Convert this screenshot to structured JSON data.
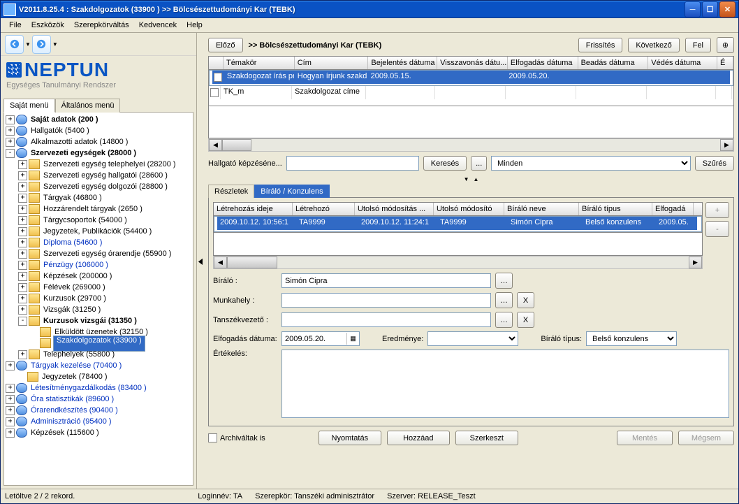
{
  "title": "V2011.8.25.4 : Szakdolgozatok (33900  )  >> Bölcsészettudományi Kar (TEBK)",
  "menu": [
    "File",
    "Eszközök",
    "Szerepkörváltás",
    "Kedvencek",
    "Help"
  ],
  "logo": {
    "name": "NEPTUN",
    "sub": "Egységes Tanulmányi Rendszer"
  },
  "left_tabs": [
    "Saját menü",
    "Általános menü"
  ],
  "tree": [
    {
      "ind": 0,
      "exp": "+",
      "ico": "blue",
      "label": "Saját adatok (200  )",
      "bold": true
    },
    {
      "ind": 0,
      "exp": "+",
      "ico": "blue",
      "label": "Hallgatók (5400  )"
    },
    {
      "ind": 0,
      "exp": "+",
      "ico": "blue",
      "label": "Alkalmazotti adatok (14800  )"
    },
    {
      "ind": 0,
      "exp": "-",
      "ico": "blue",
      "label": "Szervezeti egységek (28000  )",
      "bold": true
    },
    {
      "ind": 1,
      "exp": "+",
      "ico": "y",
      "label": "Szervezeti egység telephelyei (28200  )"
    },
    {
      "ind": 1,
      "exp": "+",
      "ico": "y",
      "label": "Szervezeti egység hallgatói (28600  )"
    },
    {
      "ind": 1,
      "exp": "+",
      "ico": "y",
      "label": "Szervezeti egység dolgozói (28800  )"
    },
    {
      "ind": 1,
      "exp": "+",
      "ico": "y",
      "label": "Tárgyak (46800  )"
    },
    {
      "ind": 1,
      "exp": "+",
      "ico": "y",
      "label": "Hozzárendelt tárgyak (2650  )"
    },
    {
      "ind": 1,
      "exp": "+",
      "ico": "y",
      "label": "Tárgycsoportok (54000  )"
    },
    {
      "ind": 1,
      "exp": "+",
      "ico": "y",
      "label": "Jegyzetek, Publikációk (54400  )"
    },
    {
      "ind": 1,
      "exp": "+",
      "ico": "y",
      "label": "Diploma (54600  )",
      "link": true
    },
    {
      "ind": 1,
      "exp": "+",
      "ico": "y",
      "label": "Szervezeti egység órarendje (55900  )"
    },
    {
      "ind": 1,
      "exp": "+",
      "ico": "y",
      "label": "Pénzügy (106000  )",
      "link": true
    },
    {
      "ind": 1,
      "exp": "+",
      "ico": "y",
      "label": "Képzések (200000  )"
    },
    {
      "ind": 1,
      "exp": "+",
      "ico": "y",
      "label": "Félévek (269000  )"
    },
    {
      "ind": 1,
      "exp": "+",
      "ico": "y",
      "label": "Kurzusok (29700  )"
    },
    {
      "ind": 1,
      "exp": "+",
      "ico": "y",
      "label": "Vizsgák (31250  )"
    },
    {
      "ind": 1,
      "exp": "-",
      "ico": "y",
      "label": "Kurzusok vizsgái (31350  )",
      "bold": true
    },
    {
      "ind": 2,
      "exp": " ",
      "ico": "y",
      "label": "Elküldött üzenetek (32150  )"
    },
    {
      "ind": 2,
      "exp": " ",
      "ico": "y",
      "label": "Szakdolgozatok (33900  )",
      "sel": true
    },
    {
      "ind": 1,
      "exp": "+",
      "ico": "y",
      "label": "Telephelyek (55800  )"
    },
    {
      "ind": 0,
      "exp": "+",
      "ico": "blue",
      "label": "Tárgyak kezelése (70400  )",
      "link": true
    },
    {
      "ind": 1,
      "exp": " ",
      "ico": "y",
      "label": "Jegyzetek (78400  )"
    },
    {
      "ind": 0,
      "exp": "+",
      "ico": "blue",
      "label": "Létesítménygazdálkodás (83400  )",
      "link": true
    },
    {
      "ind": 0,
      "exp": "+",
      "ico": "blue",
      "label": "Óra statisztikák (89600  )",
      "link": true
    },
    {
      "ind": 0,
      "exp": "+",
      "ico": "blue",
      "label": "Órarendkészítés (90400  )",
      "link": true
    },
    {
      "ind": 0,
      "exp": "+",
      "ico": "blue",
      "label": "Adminisztráció (95400  )",
      "link": true
    },
    {
      "ind": 0,
      "exp": "+",
      "ico": "blue",
      "label": "Képzések (115600  )"
    }
  ],
  "top": {
    "prev": "Előző",
    "path": ">>  Bölcsészettudományi Kar (TEBK)",
    "refresh": "Frissítés",
    "next": "Következő",
    "up": "Fel"
  },
  "gridTop": {
    "cols": [
      "",
      "Témakör",
      "Cím",
      "Bejelentés dátuma",
      "Visszavonás dátu...",
      "Elfogadás dátuma",
      "Beadás dátuma",
      "Védés dátuma",
      "É"
    ],
    "rows": [
      {
        "sel": true,
        "c": [
          "Szakdogozat írás pr",
          "Hogyan írjunk szakd",
          "2009.05.15.",
          "",
          "2009.05.20.",
          "",
          "",
          ""
        ]
      },
      {
        "sel": false,
        "c": [
          "TK_m",
          "Szakdolgozat címe",
          "",
          "",
          "",
          "",
          "",
          ""
        ]
      }
    ]
  },
  "search": {
    "label": "Hallgató képzéséne...",
    "btn": "Keresés",
    "ell": "...",
    "filterSel": "Minden",
    "filterBtn": "Szűrés"
  },
  "subtabs": [
    "Részletek",
    "Bíráló / Konzulens"
  ],
  "gridSub": {
    "cols": [
      "Létrehozás ideje",
      "Létrehozó",
      "Utolsó módosítás ...",
      "Utolsó módosító",
      "Bíráló neve",
      "Bíráló típus",
      "Elfogadá"
    ],
    "rows": [
      {
        "sel": true,
        "c": [
          "2009.10.12. 10:56:1",
          "TA9999",
          "2009.10.12. 11:24:1",
          "TA9999",
          "Simón Cipra",
          "Belső konzulens",
          "2009.05."
        ]
      }
    ]
  },
  "form": {
    "biralo": "Bíráló :",
    "biralo_v": "Simón Cipra",
    "munka": "Munkahely :",
    "tanszek": "Tanszékvezető :",
    "elf": "Elfogadás dátuma:",
    "elf_v": "2009.05.20.",
    "ered": "Eredménye:",
    "tipus": "Bíráló típus:",
    "tipus_v": "Belső konzulens",
    "ert": "Értékelés:"
  },
  "bottom": {
    "arch": "Archiváltak is",
    "print": "Nyomtatás",
    "add": "Hozzáad",
    "edit": "Szerkeszt",
    "save": "Mentés",
    "cancel": "Mégsem"
  },
  "status": {
    "rec": "Letöltve 2 / 2 rekord.",
    "login": "Loginnév: TA",
    "role": "Szerepkör: Tanszéki adminisztrátor",
    "srv": "Szerver: RELEASE_Teszt"
  }
}
